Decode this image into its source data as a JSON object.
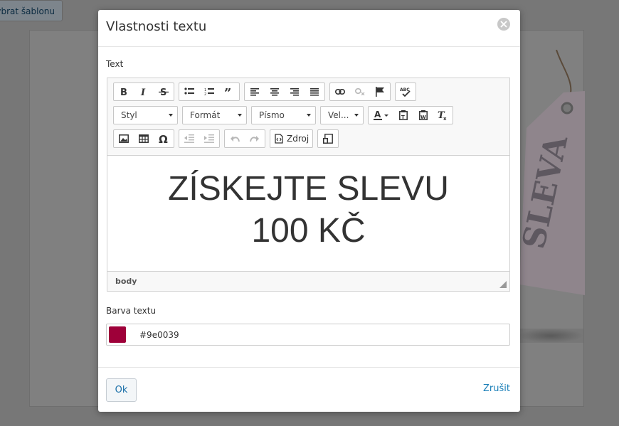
{
  "background": {
    "template_button_label": "ybrat šablonu",
    "tag_text": "SLEVA"
  },
  "dialog": {
    "title": "Vlastnosti textu",
    "close_icon": "close-icon",
    "text_label": "Text",
    "toolbar": {
      "style_combo": "Styl",
      "format_combo": "Formát",
      "font_combo": "Písmo",
      "size_combo": "Vel...",
      "source_label": "Zdroj",
      "icons": [
        "bold-icon",
        "italic-icon",
        "strikethrough-icon",
        "bulleted-list-icon",
        "numbered-list-icon",
        "blockquote-icon",
        "align-left-icon",
        "align-center-icon",
        "align-right-icon",
        "justify-icon",
        "link-icon",
        "unlink-icon",
        "anchor-flag-icon",
        "spellcheck-icon",
        "text-color-icon",
        "paste-text-icon",
        "paste-word-icon",
        "remove-format-icon",
        "image-icon",
        "table-icon",
        "special-char-icon",
        "outdent-icon",
        "indent-icon",
        "undo-icon",
        "redo-icon",
        "source-icon",
        "preview-icon"
      ]
    },
    "content": {
      "line1": "ZÍSKEJTE SLEVU",
      "line2": "100 KČ"
    },
    "statusbar_path": "body",
    "color_label": "Barva textu",
    "color_value": "#9e0039",
    "ok_label": "Ok",
    "cancel_label": "Zrušit"
  },
  "colors": {
    "swatch": "#9e0039",
    "accent_link": "#1a7fb8"
  }
}
